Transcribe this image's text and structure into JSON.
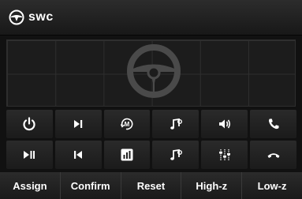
{
  "header": {
    "title": "swc",
    "logo_icon": "steering-wheel-logo-icon"
  },
  "wheel_icon": "steering-wheel-icon",
  "buttons": [
    {
      "icon": "power-icon"
    },
    {
      "icon": "play-next-icon"
    },
    {
      "icon": "mode-icon",
      "glyph": "M"
    },
    {
      "icon": "music-note-icon"
    },
    {
      "icon": "volume-icon"
    },
    {
      "icon": "phone-answer-icon"
    },
    {
      "icon": "play-pause-icon"
    },
    {
      "icon": "previous-icon"
    },
    {
      "icon": "equalizer-bars-icon"
    },
    {
      "icon": "music-note-icon"
    },
    {
      "icon": "mixer-sliders-icon"
    },
    {
      "icon": "phone-hangup-icon"
    }
  ],
  "actions": {
    "assign": "Assign",
    "confirm": "Confirm",
    "reset": "Reset",
    "high_z": "High-z",
    "low_z": "Low-z"
  }
}
